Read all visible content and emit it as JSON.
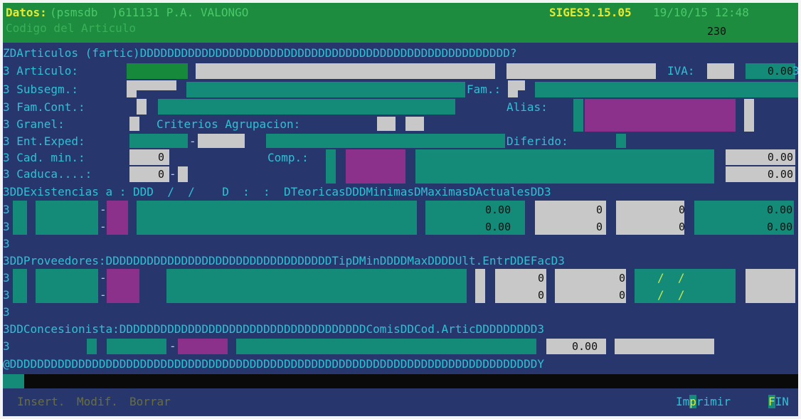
{
  "header": {
    "datos_label": "Datos:",
    "datos_value": "(psmsdb  )611131 P.A. VALONGO",
    "version": "SIGES3.15.05",
    "datetime": "19/10/15 12:48",
    "codigo_label": "Codigo del Articulo",
    "codigo_value": "230"
  },
  "articulos": {
    "section": "ZDArticulos (fartic)DDDDDDDDDDDDDDDDDDDDDDDDDDDDDDDDDDDDDDDDDDDDDDDDDDDDDD?",
    "articulo_label": "3 Articulo:",
    "iva_label": "IVA:",
    "iva_value": "0.00",
    "subsegm_label": "3 Subsegm.:",
    "fam_label": "Fam.:",
    "famcont_label": "3 Fam.Cont.:",
    "alias_label": "Alias:",
    "granel_label": "3 Granel:",
    "criterios_label": "Criterios Agrupacion:",
    "entexped_label": "3 Ent.Exped:",
    "dash": "-",
    "diferido_label": "Diferido:",
    "cadmin_label": "3 Cad. min.:",
    "cadmin_value": "0",
    "comp_label": "Comp.:",
    "comp_value": "0.00",
    "caduca_label": "3 Caduca....:",
    "caduca_value": "0",
    "caduca_right_value": "0.00",
    "edge": "3"
  },
  "existencias": {
    "header": "3DDExistencias a : DDD  /  /    D  :  :  DTeoricasDDDMinimasDMaximasDActualesDD3",
    "row1": {
      "teoricas": "0.00",
      "minimas": "0",
      "maximas": "0",
      "actuales": "0.00"
    },
    "row2": {
      "teoricas": "0.00",
      "minimas": "0",
      "maximas": "0",
      "actuales": "0.00"
    }
  },
  "proveedores": {
    "header": "3DDProveedores:DDDDDDDDDDDDDDDDDDDDDDDDDDDDDDDDDTipDMinDDDDMaxDDDDUlt.EntrDDEFacD3",
    "row1": {
      "min": "0",
      "max": "0",
      "ult": "/  /"
    },
    "row2": {
      "min": "0",
      "max": "0",
      "ult": "/  /"
    }
  },
  "concesionista": {
    "header": "3DDConcesionista:DDDDDDDDDDDDDDDDDDDDDDDDDDDDDDDDDDDDComisDDCod.ArticDDDDDDDDD3",
    "comis_value": "0.00"
  },
  "bottom_border": "@DDDDDDDDDDDDDDDDDDDDDDDDDDDDDDDDDDDDDDDDDDDDDDDDDDDDDDDDDDDDDDDDDDDDDDDDDDDDDY",
  "footer": {
    "insert": "Insert.",
    "modif": "Modif.",
    "borrar": "Borrar",
    "imprimir_a": "Im",
    "imprimir_b": "p",
    "imprimir_c": "rimir",
    "fin_f": "F",
    "fin_rest": "IN"
  },
  "colors": {
    "background": "#27376e",
    "field_green": "#148a78",
    "field_gray": "#c8c8c8",
    "field_magenta": "#8b318c",
    "title_green": "#1d8c3e",
    "text_cyan": "#2ec1d3"
  }
}
